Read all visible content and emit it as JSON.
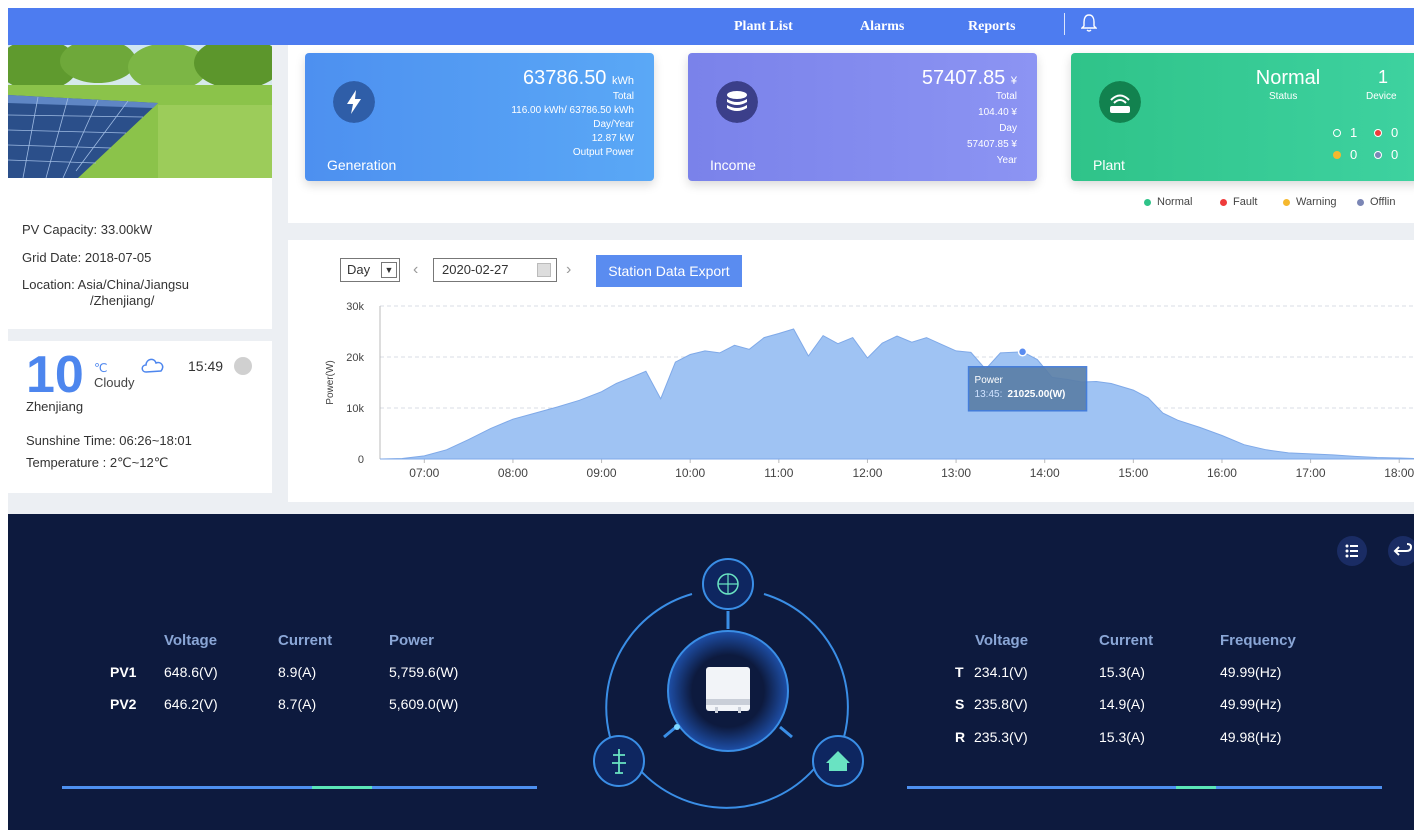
{
  "nav": {
    "items": [
      "Plant List",
      "Alarms",
      "Reports"
    ]
  },
  "plant_info": {
    "pv_capacity_label": "PV Capacity:",
    "pv_capacity": "33.00kW",
    "grid_date_label": "Grid Date:",
    "grid_date": "2018-07-05",
    "location_label": "Location:",
    "location_line1": "Asia/China/Jiangsu",
    "location_line2": "/Zhenjiang/"
  },
  "weather": {
    "temp": "10",
    "unit": "℃",
    "condition": "Cloudy",
    "time": "15:49",
    "city": "Zhenjiang",
    "sunshine_label": "Sunshine Time:",
    "sunshine": "06:26~18:01",
    "temperature_label": "Temperature  :",
    "temperature": "2℃~12℃"
  },
  "generation": {
    "total": "63786.50",
    "total_unit": "kWh",
    "total_label": "Total",
    "dayyear": "116.00 kWh/ 63786.50 kWh",
    "dayyear_label": "Day/Year",
    "output": "12.87 kW",
    "output_label": "Output Power",
    "title": "Generation"
  },
  "income": {
    "total": "57407.85",
    "total_unit": "¥",
    "total_label": "Total",
    "day": "104.40 ¥",
    "day_label": "Day",
    "year": "57407.85 ¥",
    "year_label": "Year",
    "title": "Income"
  },
  "plant": {
    "status": "Normal",
    "status_label": "Status",
    "device_count": "1",
    "device_label": "Device",
    "normal_count": "1",
    "fault_count": "0",
    "warning_count": "0",
    "offline_count": "0",
    "title": "Plant"
  },
  "legend": [
    "Normal",
    "Fault",
    "Warning",
    "Offlin"
  ],
  "colors": {
    "normal": "#2fc389",
    "fault": "#ef3b3b",
    "warning": "#f5b82e",
    "offline": "#7b86b5"
  },
  "controls": {
    "period": "Day",
    "date": "2020-02-27",
    "export_label": "Station Data Export"
  },
  "chart_data": {
    "type": "area",
    "ylabel": "Power(W)",
    "yticks": [
      "30k",
      "20k",
      "10k",
      "0"
    ],
    "ylim": [
      0,
      30000
    ],
    "xticks": [
      "07:00",
      "08:00",
      "09:00",
      "10:00",
      "11:00",
      "12:00",
      "13:00",
      "14:00",
      "15:00",
      "16:00",
      "17:00",
      "18:00"
    ],
    "xlim": [
      "06:30",
      "18:10"
    ],
    "grid": true,
    "series": [
      {
        "x": [
          "06:30",
          "06:45",
          "07:00",
          "07:15",
          "07:30",
          "07:45",
          "08:00",
          "08:15",
          "08:30",
          "08:45",
          "09:00",
          "09:10",
          "09:20",
          "09:30",
          "09:40",
          "09:50",
          "10:00",
          "10:10",
          "10:20",
          "10:30",
          "10:40",
          "10:50",
          "11:00",
          "11:10",
          "11:20",
          "11:30",
          "11:40",
          "11:50",
          "12:00",
          "12:10",
          "12:20",
          "12:30",
          "12:40",
          "12:50",
          "13:00",
          "13:10",
          "13:20",
          "13:30",
          "13:45",
          "13:55",
          "14:05",
          "14:15",
          "14:25",
          "14:35",
          "14:45",
          "15:00",
          "15:10",
          "15:20",
          "15:30",
          "15:45",
          "16:00",
          "16:15",
          "16:30",
          "16:45",
          "17:00",
          "17:15",
          "17:30",
          "17:45",
          "18:00",
          "18:10"
        ],
        "values": [
          0,
          100,
          600,
          1800,
          3800,
          6000,
          7800,
          9000,
          10200,
          11500,
          13200,
          14800,
          16000,
          17200,
          11800,
          19000,
          20500,
          21200,
          20800,
          22300,
          21500,
          23800,
          24600,
          25500,
          20200,
          24200,
          22600,
          23800,
          19800,
          22700,
          24100,
          22900,
          23800,
          22500,
          21200,
          20900,
          17600,
          20800,
          21025,
          19500,
          16000,
          15600,
          15100,
          15200,
          14800,
          13500,
          12000,
          9000,
          7600,
          6200,
          4600,
          2800,
          1800,
          1200,
          1000,
          800,
          500,
          300,
          200,
          100
        ]
      }
    ],
    "tooltip": {
      "title": "Power",
      "time": "13:45:",
      "value": "21025.00(W)"
    }
  },
  "dc": {
    "headers": [
      "Voltage",
      "Current",
      "Power"
    ],
    "rows": [
      {
        "label": "PV1",
        "voltage": "648.6(V)",
        "current": "8.9(A)",
        "power": "5,759.6(W)"
      },
      {
        "label": "PV2",
        "voltage": "646.2(V)",
        "current": "8.7(A)",
        "power": "5,609.0(W)"
      }
    ]
  },
  "ac": {
    "headers": [
      "Voltage",
      "Current",
      "Frequency"
    ],
    "rows": [
      {
        "label": "T",
        "voltage": "234.1(V)",
        "current": "15.3(A)",
        "frequency": "49.99(Hz)"
      },
      {
        "label": "S",
        "voltage": "235.8(V)",
        "current": "14.9(A)",
        "frequency": "49.99(Hz)"
      },
      {
        "label": "R",
        "voltage": "235.3(V)",
        "current": "15.3(A)",
        "frequency": "49.98(Hz)"
      }
    ]
  }
}
